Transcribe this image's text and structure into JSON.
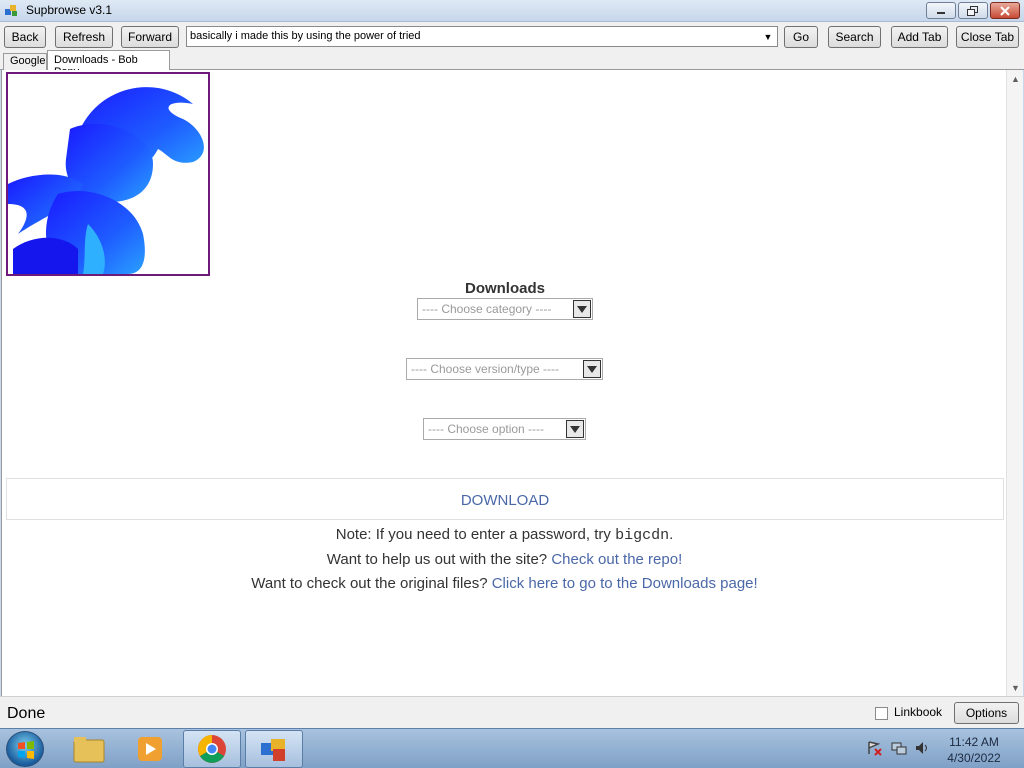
{
  "window": {
    "title": "Supbrowse v3.1"
  },
  "toolbar": {
    "back": "Back",
    "refresh": "Refresh",
    "forward": "Forward",
    "address_value": "basically i made this by using the power of tried",
    "go": "Go",
    "search": "Search",
    "add_tab": "Add Tab",
    "close_tab": "Close Tab"
  },
  "tabs": [
    {
      "label": "Google"
    },
    {
      "label": "Downloads - Bob Pony"
    }
  ],
  "page": {
    "heading": "Downloads",
    "category_placeholder": "---- Choose category ----",
    "version_placeholder": "---- Choose version/type ----",
    "option_placeholder": "---- Choose option ----",
    "download_label": "DOWNLOAD",
    "note_prefix": "Note: If you need to enter a password, try ",
    "note_password": "bigcdn",
    "note_suffix": ".",
    "help_prefix": "Want to help us out with the site? ",
    "help_link": "Check out the repo!",
    "files_prefix": "Want to check out the original files? ",
    "files_link": "Click here to go to the Downloads page!"
  },
  "statusbar": {
    "status": "Done",
    "linkbook_label": "Linkbook",
    "linkbook_checked": false,
    "options": "Options"
  },
  "taskbar": {
    "time": "11:42 AM",
    "date": "4/30/2022"
  },
  "colors": {
    "link": "#4a68a8",
    "logo_border": "#6d1a7a",
    "logo_blue": "#1f3cff"
  }
}
